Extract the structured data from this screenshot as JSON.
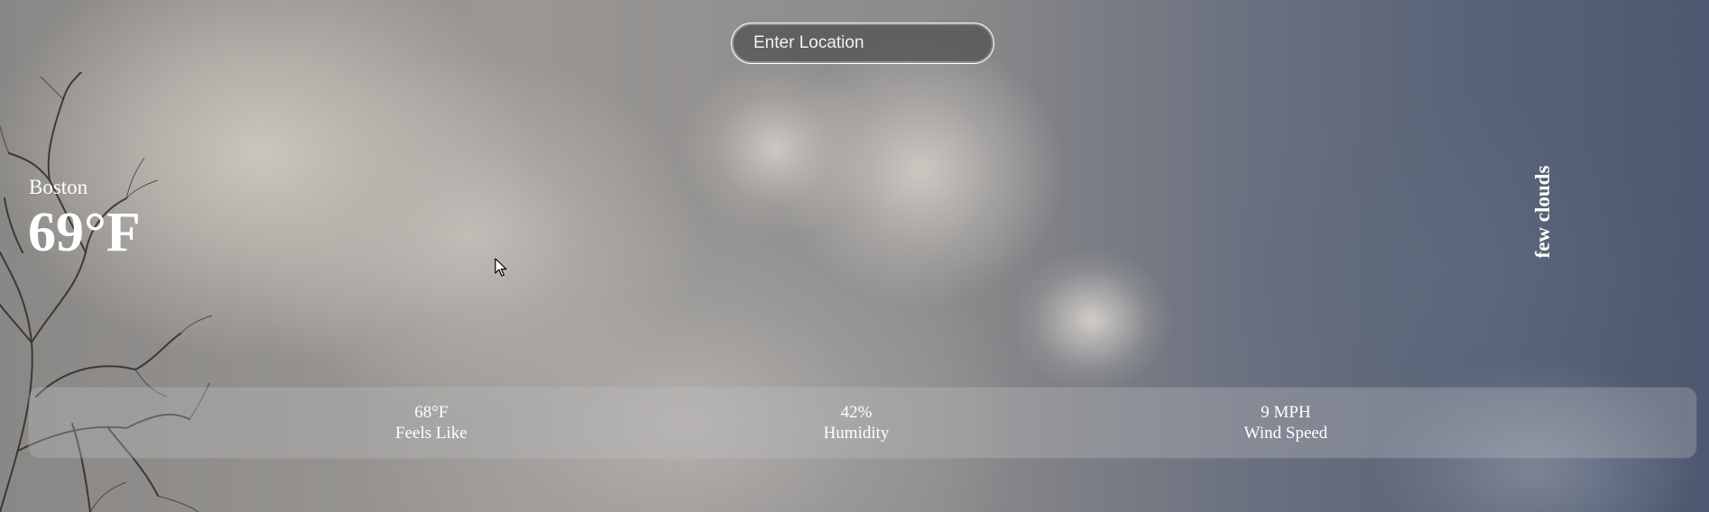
{
  "search": {
    "placeholder": "Enter Location"
  },
  "location": {
    "city": "Boston",
    "temperature": "69°F"
  },
  "conditions": {
    "description": "few clouds"
  },
  "stats": [
    {
      "value": "68°F",
      "label": "Feels Like"
    },
    {
      "value": "42%",
      "label": "Humidity"
    },
    {
      "value": "9 MPH",
      "label": "Wind Speed"
    }
  ],
  "colors": {
    "text": "#ffffff",
    "search_bg": "#555255",
    "panel_bg": "#bebec3"
  }
}
